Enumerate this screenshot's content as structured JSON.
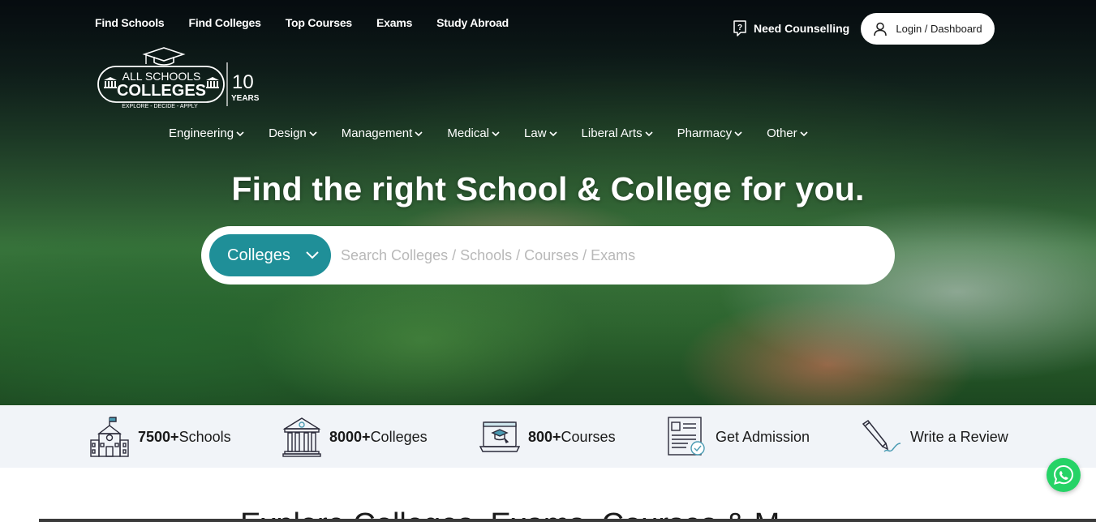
{
  "topnav": {
    "items": [
      "Find Schools",
      "Find Colleges",
      "Top Courses",
      "Exams",
      "Study Abroad"
    ]
  },
  "header": {
    "counselling": "Need Counselling",
    "login": "Login / Dashboard"
  },
  "logo": {
    "line1": "ALL SCHOOLS",
    "line2": "COLLEGES",
    "tagline": "EXPLORE - DECIDE - APPLY",
    "years_number": "10",
    "years_label": "YEARS"
  },
  "categories": [
    "Engineering",
    "Design",
    "Management",
    "Medical",
    "Law",
    "Liberal Arts",
    "Pharmacy",
    "Other"
  ],
  "hero": {
    "title": "Find the right School & College for you."
  },
  "search": {
    "type_selected": "Colleges",
    "placeholder": "Search Colleges / Schools / Courses / Exams"
  },
  "stats": [
    {
      "number": "7500+",
      "label": "Schools",
      "icon": "school-building-icon"
    },
    {
      "number": "8000+",
      "label": "Colleges",
      "icon": "college-pillars-icon"
    },
    {
      "number": "800+",
      "label": "Courses",
      "icon": "laptop-graduation-icon"
    },
    {
      "number": "",
      "label": "Get Admission",
      "icon": "admission-form-icon"
    },
    {
      "number": "",
      "label": "Write a Review",
      "icon": "pen-review-icon"
    }
  ],
  "section": {
    "partial_title": "Explore Colleges, Exams, Courses & M"
  },
  "colors": {
    "accent": "#1f8f98",
    "stats_bg": "#f1f4f8",
    "whatsapp": "#25d366"
  }
}
